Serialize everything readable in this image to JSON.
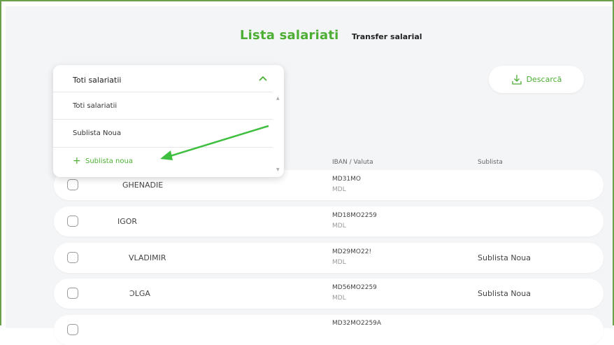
{
  "header": {
    "title": "Lista salariati",
    "tab_transfer": "Transfer salarial",
    "download_label": "Descarcă"
  },
  "filter": {
    "selected": "Toti salariatii",
    "options": [
      "Toti salariatii",
      "Sublista Noua"
    ],
    "add_icon": "+",
    "add_label": "Sublista noua"
  },
  "table": {
    "columns": {
      "iban": "IBAN / Valuta",
      "sublist": "Sublista"
    },
    "rows": [
      {
        "name": "GHENADIE",
        "iban": "MD31MO",
        "currency": "MDL",
        "sublist": ""
      },
      {
        "name": "IGOR",
        "iban": "MD18MO2259",
        "currency": "MDL",
        "sublist": ""
      },
      {
        "name": "VLADIMIR",
        "iban": "MD29MO22!",
        "currency": "MDL",
        "sublist": "Sublista Noua"
      },
      {
        "name": "ϽLGA",
        "iban": "MD56MO2259",
        "currency": "MDL",
        "sublist": "Sublista Noua"
      },
      {
        "name": "",
        "iban": "MD32MO2259A",
        "currency": "",
        "sublist": ""
      }
    ]
  },
  "colors": {
    "accent": "#4cae33",
    "frame": "#6aa04a",
    "background": "#f4f5f7"
  },
  "icons": {
    "download": "download-icon",
    "chevron": "chevron-up-icon"
  }
}
